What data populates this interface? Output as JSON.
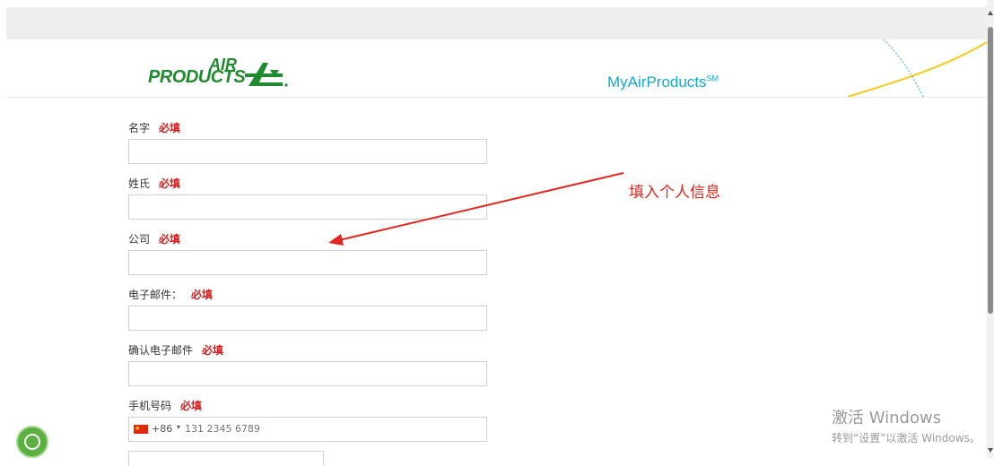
{
  "header": {
    "logo_air": "AIR",
    "logo_products": "PRODUCTS",
    "brand_title": "MyAirProducts",
    "brand_mark": "SM"
  },
  "form": {
    "required_text": "必填",
    "fields": [
      {
        "label": "名字",
        "value": ""
      },
      {
        "label": "姓氏",
        "value": ""
      },
      {
        "label": "公司",
        "value": ""
      },
      {
        "label": "电子邮件：",
        "value": ""
      },
      {
        "label": "确认电子邮件",
        "value": ""
      },
      {
        "label": "手机号码",
        "value": ""
      }
    ],
    "phone": {
      "country_code": "+86",
      "caret": "▾",
      "placeholder": "131 2345 6789"
    }
  },
  "annotation": {
    "text": "填入个人信息",
    "color": "#e4261f"
  },
  "watermark": {
    "title": "激活 Windows",
    "subtitle": "转到“设置”以激活 Windows。"
  },
  "colors": {
    "brand_green": "#1f8a2e",
    "brand_blue": "#13a9c8",
    "required_red": "#d21c1c",
    "cookie_green": "#5ab142"
  },
  "icons": {
    "cookie_button": "cookie-settings-icon"
  }
}
